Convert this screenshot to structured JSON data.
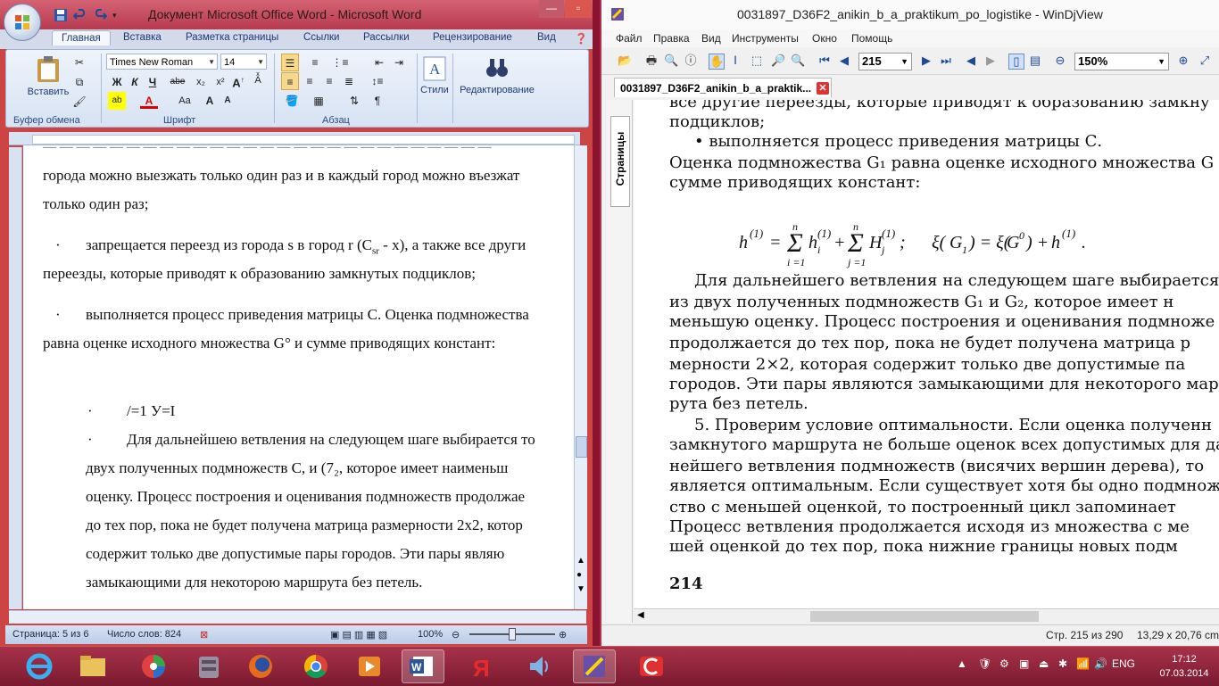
{
  "word": {
    "title": "Документ Microsoft Office Word - Microsoft Word",
    "tabs": [
      "Главная",
      "Вставка",
      "Разметка страницы",
      "Ссылки",
      "Рассылки",
      "Рецензирование",
      "Вид"
    ],
    "ribbon": {
      "paste_label": "Вставить",
      "clipboard_label": "Буфер обмена",
      "font_name": "Times New Roman",
      "font_size": "14",
      "font_group_label": "Шрифт",
      "paragraph_label": "Абзац",
      "styles_label": "Стили",
      "editing_label": "Редактирование"
    },
    "document": {
      "line1": "городa можно выезжать только один раз и в каждый город можно въезжат",
      "line2": "только один раз;",
      "bullet1_a": "запрещается переезд из города s в город r (C",
      "bullet1_sub": "sr",
      "bullet1_b": " - x), а также все други",
      "line4": "переезды, которые приводят к образованию замкнутых подциклов;",
      "bullet2": "выполняется процесс приведения матрицы С. Оценка подмножества",
      "line6": "равна оценке исходного множества G° и сумме приводящих констант:",
      "bullet3": "/=1 У=I",
      "bullet4": "Для дальнейшею ветвления на следующем шаге выбирается то",
      "line9": "двух полученных подмножеств С, и (7₂, которое имеет наименьш",
      "line10": "оценку. Процесс построения и оценивания подмножеств продолжае",
      "line11": "до тех пор, пока не будет получена матрица размерности 2x2, котор",
      "line12": "содержит только две допустимые пары городов. Эти пары являю",
      "line13": "замыкающими для некоторою маршрута без петель.",
      "bullet_char": "·"
    },
    "status": {
      "page": "Страница: 5 из 6",
      "words": "Число слов: 824",
      "zoom": "100%"
    }
  },
  "djview": {
    "title": "0031897_D36F2_anikin_b_a_praktikum_po_logistike - WinDjView",
    "menu": [
      "Файл",
      "Правка",
      "Вид",
      "Инструменты",
      "Окно",
      "Помощь"
    ],
    "page_combo": "215",
    "zoom_combo": "150%",
    "tab_label": "0031897_D36F2_anikin_b_a_praktik...",
    "side_tab": "Страницы",
    "page_text": {
      "l1": "все другие переезды, которые приводят к образованию замкну",
      "l2": "подциклов;",
      "l3": "• выполняется процесс приведения матрицы С.",
      "l4": "Оценка подмножества G₁ равна оценке исходного множества G",
      "l5": "сумме приводящих констант:",
      "formula": "h(1) = Σ h(1) + Σ H(1);    ξ(G1) = ξ(G0) + h(1).",
      "p1": "Для дальнейшего ветвления на следующем шаге выбирается",
      "p2": "из двух полученных подмножеств G₁ и G₂, которое имеет н",
      "p3": "меньшую оценку. Процесс построения и оценивания подмноже",
      "p4": "продолжается до тех пор, пока не будет получена матрица р",
      "p5": "мерности 2×2, которая содержит только две допустимые па",
      "p6": "городов. Эти пары являются замыкающими для некоторого мар",
      "p7": "рута без петель.",
      "p8": "5. Проверим условие оптимальности. Если оценка полученн",
      "p9": "замкнутого маршрута не больше оценок всех допустимых для да",
      "p10": "нейшего ветвления подмножеств (висячих вершин дерева), то",
      "p11": "является оптимальным. Если существует хотя бы одно подмнож",
      "p12": "ство с меньшей оценкой, то построенный цикл запоминает",
      "p13": "Процесс ветвления продолжается исходя из множества с ме",
      "p14": "шей оценкой до тех пор, пока нижние границы новых подм",
      "page_number": "214"
    },
    "status": {
      "pages": "Стр. 215 из 290",
      "size": "13,29 x 20,76 cm"
    }
  },
  "taskbar": {
    "language": "ENG",
    "time": "17:12",
    "date": "07.03.2014"
  },
  "colors": {
    "taskbar": "#8a1430",
    "word_title": "#c44055",
    "ribbon": "#dfe8f5"
  }
}
